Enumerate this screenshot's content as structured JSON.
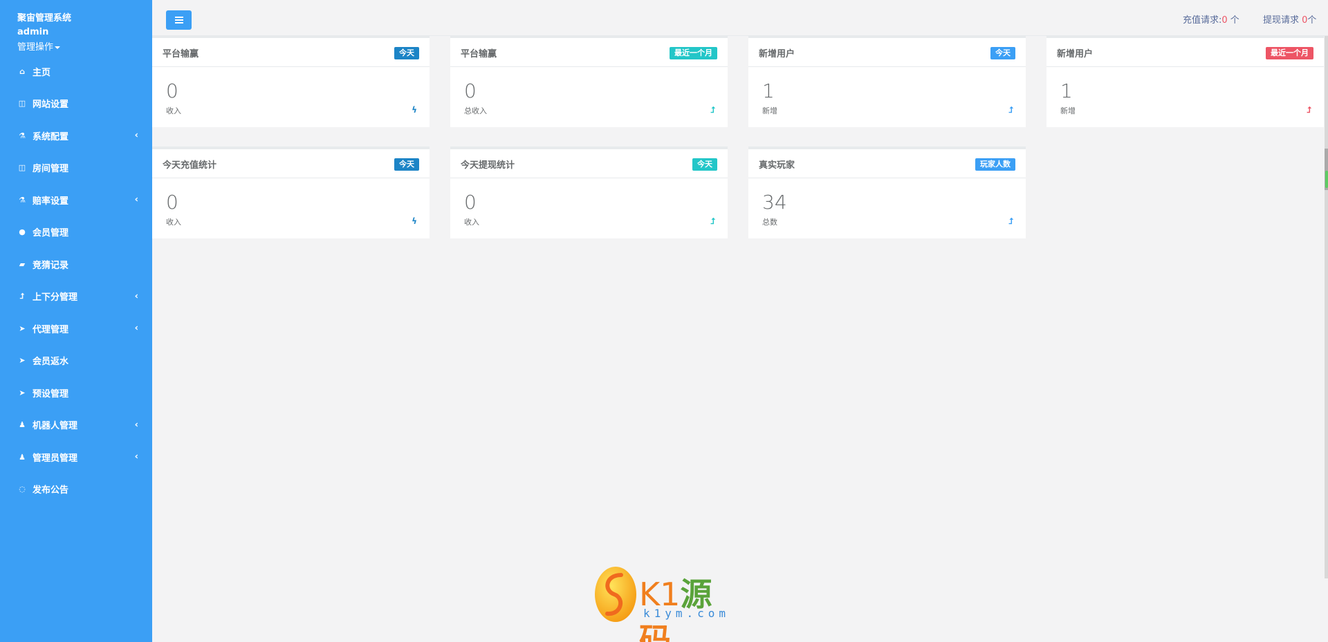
{
  "sidebar": {
    "brand": "聚宙管理系统",
    "user_name": "admin",
    "user_ops": "管理操作",
    "items": [
      {
        "label": "主页",
        "icon": "home-icon",
        "has_arrow": false
      },
      {
        "label": "网站设置",
        "icon": "columns-icon",
        "has_arrow": false
      },
      {
        "label": "系统配置",
        "icon": "flask-icon",
        "has_arrow": true
      },
      {
        "label": "房间管理",
        "icon": "columns-icon",
        "has_arrow": false
      },
      {
        "label": "赔率设置",
        "icon": "flask-icon",
        "has_arrow": true
      },
      {
        "label": "会员管理",
        "icon": "user-icon",
        "has_arrow": false
      },
      {
        "label": "竞猜记录",
        "icon": "car-icon",
        "has_arrow": false
      },
      {
        "label": "上下分管理",
        "icon": "level-up-icon",
        "has_arrow": true
      },
      {
        "label": "代理管理",
        "icon": "paper-plane-icon",
        "has_arrow": true
      },
      {
        "label": "会员返水",
        "icon": "paper-plane-icon",
        "has_arrow": false
      },
      {
        "label": "预设管理",
        "icon": "paper-plane-icon",
        "has_arrow": false
      },
      {
        "label": "机器人管理",
        "icon": "male-icon",
        "has_arrow": true
      },
      {
        "label": "管理员管理",
        "icon": "male-icon",
        "has_arrow": true
      },
      {
        "label": "发布公告",
        "icon": "comment-icon",
        "has_arrow": false
      }
    ]
  },
  "topbar": {
    "recharge_label": "充值请求:",
    "recharge_count": "0",
    "recharge_unit": " 个",
    "withdraw_label": "提现请求 ",
    "withdraw_count": "0",
    "withdraw_unit": "个"
  },
  "cards": [
    {
      "title": "平台输赢",
      "badge": "今天",
      "badge_color": "#1c84c6",
      "value": "0",
      "sub": "收入",
      "icon": "bolt-icon",
      "icon_color": "#1c84c6"
    },
    {
      "title": "平台输赢",
      "badge": "最近一个月",
      "badge_color": "#23c6c8",
      "value": "0",
      "sub": "总收入",
      "icon": "level-up-icon",
      "icon_color": "#23c6c8"
    },
    {
      "title": "新增用户",
      "badge": "今天",
      "badge_color": "#3b9ff5",
      "value": "1",
      "sub": "新增",
      "icon": "level-up-icon",
      "icon_color": "#3b9ff5"
    },
    {
      "title": "新增用户",
      "badge": "最近一个月",
      "badge_color": "#ed5565",
      "value": "1",
      "sub": "新增",
      "icon": "level-up-icon",
      "icon_color": "#ed5565"
    },
    {
      "title": "今天充值统计",
      "badge": "今天",
      "badge_color": "#1c84c6",
      "value": "0",
      "sub": "收入",
      "icon": "bolt-icon",
      "icon_color": "#1c84c6"
    },
    {
      "title": "今天提现统计",
      "badge": "今天",
      "badge_color": "#23c6c8",
      "value": "0",
      "sub": "收入",
      "icon": "level-up-icon",
      "icon_color": "#23c6c8"
    },
    {
      "title": "真实玩家",
      "badge": "玩家人数",
      "badge_color": "#3b9ff5",
      "value": "34",
      "sub": "总数",
      "icon": "level-up-icon",
      "icon_color": "#3b9ff5"
    }
  ],
  "watermark": {
    "k1": "K1",
    "yuan": "源",
    "ma": "码",
    "url": "k1ym.com"
  }
}
